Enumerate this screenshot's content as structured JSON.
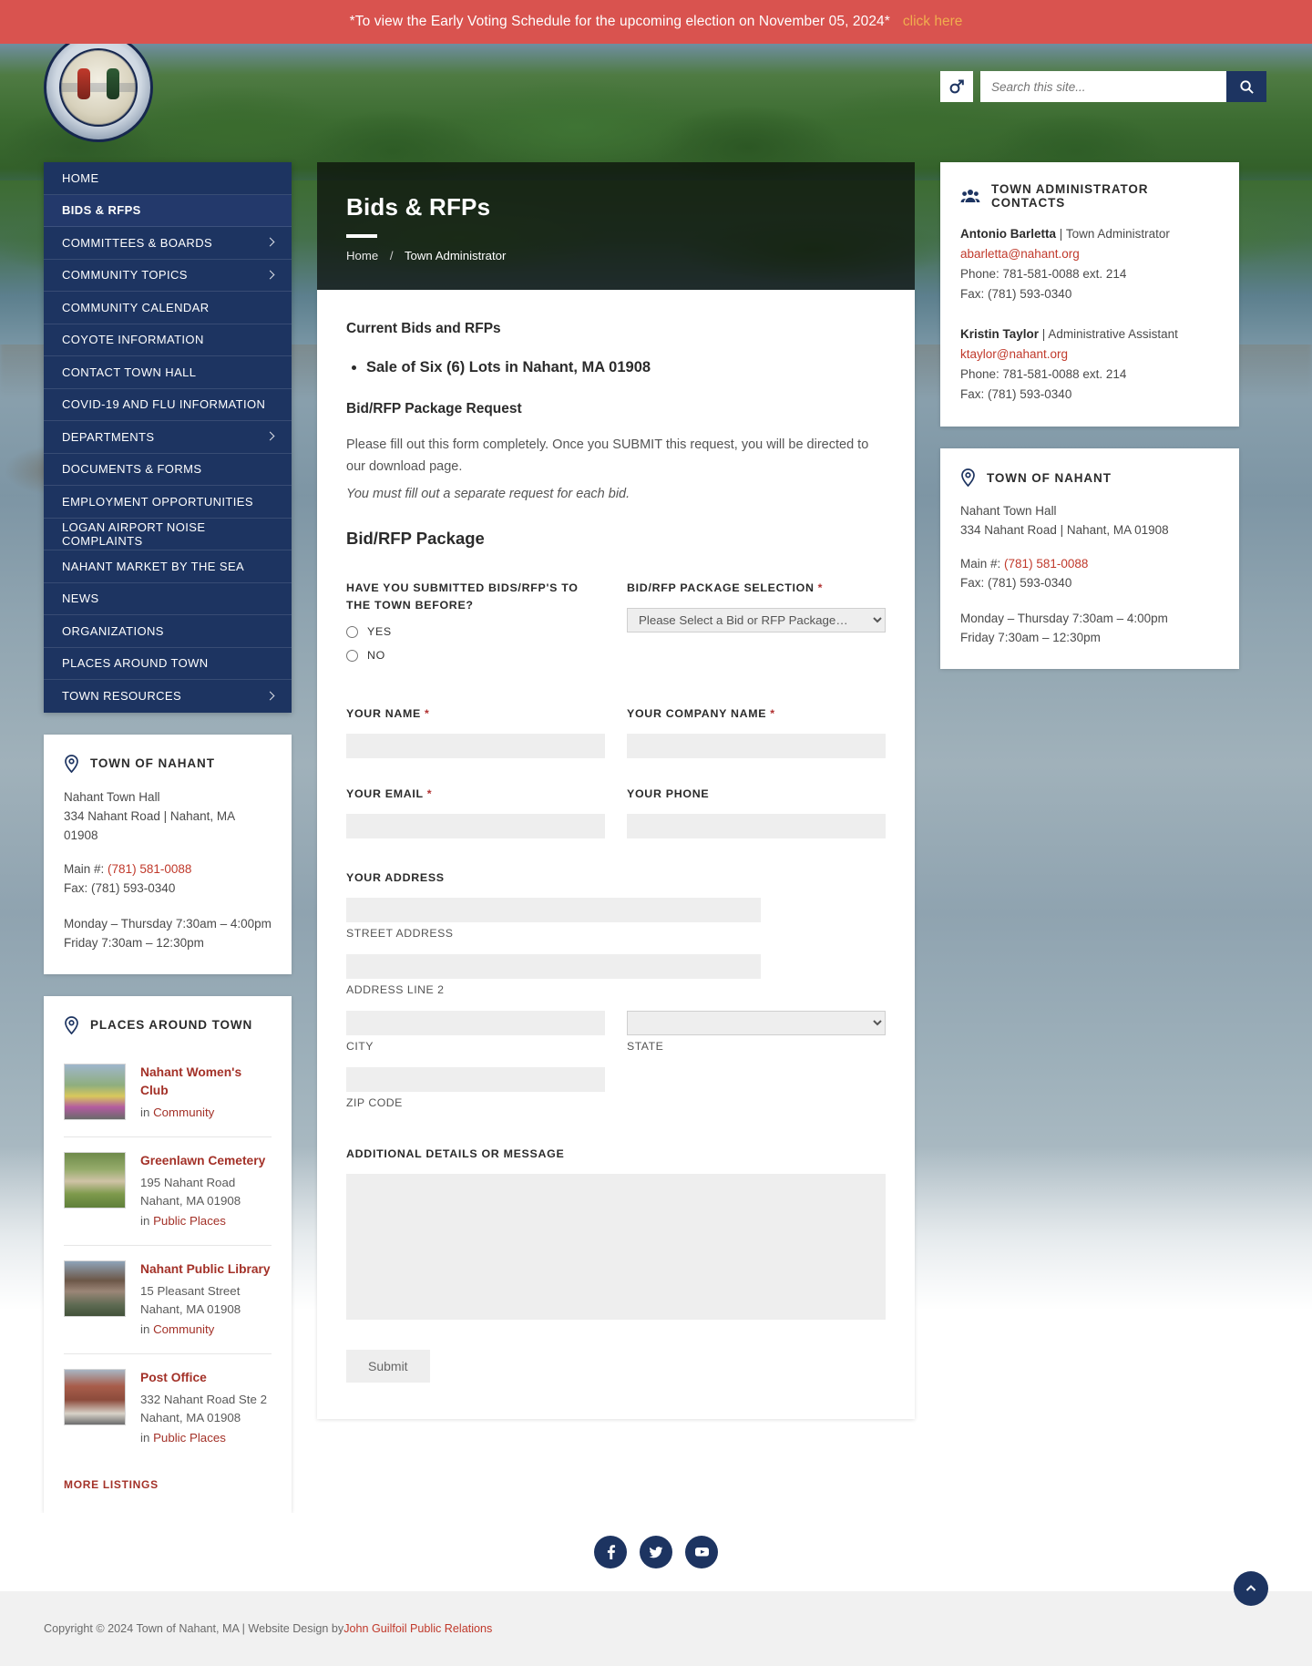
{
  "alert": {
    "text": "*To view the Early Voting Schedule for the upcoming election on November 05, 2024*",
    "link_label": "click here"
  },
  "header": {
    "search_placeholder": "Search this site...",
    "search_value": "",
    "gender_icon": "mars-icon",
    "search_icon": "search-icon",
    "seal_alt": "Town of Nahant Massachusetts Incorporated 1853 seal"
  },
  "sidebar_nav": {
    "items": [
      {
        "label": "HOME",
        "has_children": false,
        "active": false
      },
      {
        "label": "BIDS & RFPS",
        "has_children": false,
        "active": true
      },
      {
        "label": "COMMITTEES & BOARDS",
        "has_children": true,
        "active": false
      },
      {
        "label": "COMMUNITY TOPICS",
        "has_children": true,
        "active": false
      },
      {
        "label": "COMMUNITY CALENDAR",
        "has_children": false,
        "active": false
      },
      {
        "label": "COYOTE INFORMATION",
        "has_children": false,
        "active": false
      },
      {
        "label": "CONTACT TOWN HALL",
        "has_children": false,
        "active": false
      },
      {
        "label": "COVID-19 AND FLU INFORMATION",
        "has_children": false,
        "active": false
      },
      {
        "label": "DEPARTMENTS",
        "has_children": true,
        "active": false
      },
      {
        "label": "DOCUMENTS & FORMS",
        "has_children": false,
        "active": false
      },
      {
        "label": "EMPLOYMENT OPPORTUNITIES",
        "has_children": false,
        "active": false
      },
      {
        "label": "LOGAN AIRPORT NOISE COMPLAINTS",
        "has_children": false,
        "active": false
      },
      {
        "label": "NAHANT MARKET BY THE SEA",
        "has_children": false,
        "active": false
      },
      {
        "label": "NEWS",
        "has_children": false,
        "active": false
      },
      {
        "label": "ORGANIZATIONS",
        "has_children": false,
        "active": false
      },
      {
        "label": "PLACES AROUND TOWN",
        "has_children": false,
        "active": false
      },
      {
        "label": "TOWN RESOURCES",
        "has_children": true,
        "active": false
      }
    ]
  },
  "town_card": {
    "icon": "map-pin-icon",
    "title": "TOWN OF NAHANT",
    "name": "Nahant Town Hall",
    "address": "334 Nahant Road | Nahant, MA 01908",
    "main_label": "Main #:",
    "main_phone": "(781) 581-0088",
    "fax": "Fax: (781) 593-0340",
    "hours_1": "Monday – Thursday 7:30am – 4:00pm",
    "hours_2": "Friday 7:30am – 12:30pm"
  },
  "places_card": {
    "icon": "map-pin-icon",
    "title": "PLACES AROUND TOWN",
    "more_label": "MORE LISTINGS",
    "items": [
      {
        "name": "Nahant Women's Club",
        "address_1": "",
        "address_2": "",
        "cat_prefix": "in",
        "category": "Community"
      },
      {
        "name": "Greenlawn Cemetery",
        "address_1": "195 Nahant Road",
        "address_2": "Nahant, MA 01908",
        "cat_prefix": "in",
        "category": "Public Places"
      },
      {
        "name": "Nahant Public Library",
        "address_1": "15 Pleasant Street",
        "address_2": "Nahant, MA 01908",
        "cat_prefix": "in",
        "category": "Community"
      },
      {
        "name": "Post Office",
        "address_1": "332 Nahant Road Ste 2",
        "address_2": "Nahant, MA 01908",
        "cat_prefix": "in",
        "category": "Public Places"
      }
    ]
  },
  "banner": {
    "title": "Bids & RFPs",
    "breadcrumb_home": "Home",
    "breadcrumb_sep": "/",
    "breadcrumb_current": "Town Administrator"
  },
  "main": {
    "heading_current": "Current Bids and RFPs",
    "bullets": [
      "Sale of Six (6) Lots in Nahant, MA 01908"
    ],
    "heading_request": "Bid/RFP Package Request",
    "para": "Please fill out this form completely. Once you SUBMIT this request, you will be directed to our download page.",
    "para_em": "You must fill out a separate request for each bid.",
    "form_title": "Bid/RFP Package",
    "form": {
      "submitted_before_label": "HAVE YOU SUBMITTED BIDS/RFP'S TO THE TOWN BEFORE?",
      "radio_yes": "YES",
      "radio_no": "NO",
      "package_label": "BID/RFP PACKAGE SELECTION",
      "package_selected": "Please Select a Bid or RFP Package…",
      "package_options": [
        "Please Select a Bid or RFP Package…"
      ],
      "name_label": "YOUR NAME",
      "name_value": "",
      "company_label": "YOUR COMPANY NAME",
      "company_value": "",
      "email_label": "YOUR EMAIL",
      "email_value": "",
      "phone_label": "YOUR PHONE",
      "phone_value": "",
      "address_label": "YOUR ADDRESS",
      "street_sub": "STREET ADDRESS",
      "street_value": "",
      "line2_sub": "ADDRESS LINE 2",
      "line2_value": "",
      "city_sub": "CITY",
      "city_value": "",
      "state_sub": "STATE",
      "state_value": "",
      "zip_sub": "ZIP CODE",
      "zip_value": "",
      "message_label": "ADDITIONAL DETAILS OR MESSAGE",
      "message_value": "",
      "submit_label": "Submit",
      "required_mark": "*"
    }
  },
  "admin_card": {
    "icon": "people-group-icon",
    "title": "TOWN ADMINISTRATOR CONTACTS",
    "contacts": [
      {
        "name": "Antonio Barletta",
        "divider": "|",
        "role": "Town Administrator",
        "email": "abarletta@nahant.org",
        "phone": "Phone: 781-581-0088 ext. 214",
        "fax": "Fax: (781) 593-0340"
      },
      {
        "name": "Kristin Taylor",
        "divider": "|",
        "role": "Administrative Assistant",
        "email": "ktaylor@nahant.org",
        "phone": "Phone: 781-581-0088 ext. 214",
        "fax": "Fax: (781) 593-0340"
      }
    ]
  },
  "right_town_card": {
    "icon": "map-pin-icon",
    "title": "TOWN OF NAHANT",
    "name": "Nahant Town Hall",
    "address": "334 Nahant Road | Nahant, MA 01908",
    "main_label": "Main #:",
    "main_phone": "(781) 581-0088",
    "fax": "Fax: (781) 593-0340",
    "hours_1": "Monday – Thursday 7:30am – 4:00pm",
    "hours_2": "Friday 7:30am – 12:30pm"
  },
  "footer": {
    "social": [
      {
        "name": "facebook-icon",
        "label": "f"
      },
      {
        "name": "twitter-icon",
        "label": "t"
      },
      {
        "name": "youtube-icon",
        "label": "y"
      }
    ],
    "copyright_pre": "Copyright © 2024 Town of Nahant, MA | Website Design by ",
    "designer": "John Guilfoil Public Relations",
    "to_top_icon": "chevron-up-icon"
  },
  "colors": {
    "navy": "#1d3461",
    "alert_red": "#d9534f",
    "alert_link": "#f0ad4e",
    "link_red": "#c0392b",
    "place_red": "#a33128"
  }
}
